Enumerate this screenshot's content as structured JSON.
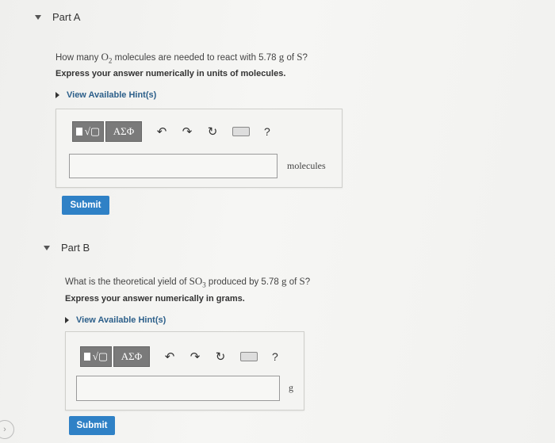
{
  "part_a": {
    "heading": "Part A",
    "question_pre": "How many ",
    "species_1": "O",
    "species_1_sub": "2",
    "question_mid": " molecules are needed to react with 5.78 ",
    "unit_g": "g",
    "question_of": " of ",
    "species_2": "S",
    "question_end": "?",
    "instruction": "Express your answer numerically in units of molecules.",
    "hint_label": "View Available Hint(s)",
    "toolbar": {
      "template_symbol": "√▢",
      "greek_label": "ΑΣΦ",
      "undo": "↶",
      "redo": "↷",
      "reset": "↻",
      "help": "?"
    },
    "input_value": "",
    "unit_label": "molecules",
    "submit_label": "Submit"
  },
  "part_b": {
    "heading": "Part B",
    "question_pre": "What is the theoretical yield of ",
    "species_1": "SO",
    "species_1_sub": "3",
    "question_mid": " produced by 5.78 ",
    "unit_g": "g",
    "question_of": " of ",
    "species_2": "S",
    "question_end": "?",
    "instruction": "Express your answer numerically in grams.",
    "hint_label": "View Available Hint(s)",
    "toolbar": {
      "template_symbol": "√▢",
      "greek_label": "ΑΣΦ",
      "undo": "↶",
      "redo": "↷",
      "reset": "↻",
      "help": "?"
    },
    "input_value": "",
    "unit_label": "g",
    "submit_label": "Submit"
  },
  "nav": {
    "arrow": "›"
  },
  "colors": {
    "submit": "#2f81c6",
    "hint_text": "#2c5f8a",
    "toolbar_button": "#7a7a7a"
  }
}
